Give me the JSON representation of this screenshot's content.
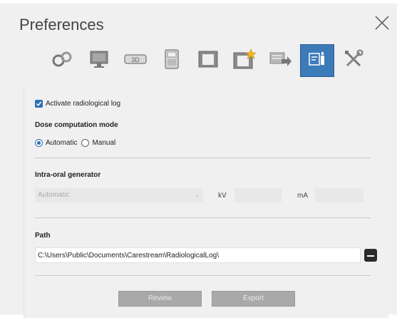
{
  "dialog": {
    "title": "Preferences",
    "close_icon": "close-icon"
  },
  "toolbar": {
    "items": [
      {
        "icon": "link-icon",
        "active": false
      },
      {
        "icon": "monitor-icon",
        "active": false
      },
      {
        "icon": "3d-icon",
        "active": false
      },
      {
        "icon": "device-icon",
        "active": false
      },
      {
        "icon": "frame-icon",
        "active": false
      },
      {
        "icon": "frame-star-icon",
        "active": false
      },
      {
        "icon": "export-icon",
        "active": false
      },
      {
        "icon": "radiological-log-icon",
        "active": true
      },
      {
        "icon": "tools-icon",
        "active": false
      }
    ],
    "active_color": "#3d7ab8"
  },
  "log": {
    "activate_label": "Activate radiological log",
    "activate_checked": true
  },
  "dose": {
    "heading": "Dose computation mode",
    "automatic_label": "Automatic",
    "manual_label": "Manual",
    "selected": "Automatic"
  },
  "generator": {
    "heading": "Intra-oral generator",
    "mode_value": "Automatic",
    "kv_label": "kV",
    "ma_label": "mA",
    "kv_value": "",
    "ma_value": ""
  },
  "path": {
    "heading": "Path",
    "value": "C:\\Users\\Public\\Documents\\Carestream\\RadiologicalLog\\"
  },
  "actions": {
    "review_label": "Review",
    "export_label": "Export"
  }
}
